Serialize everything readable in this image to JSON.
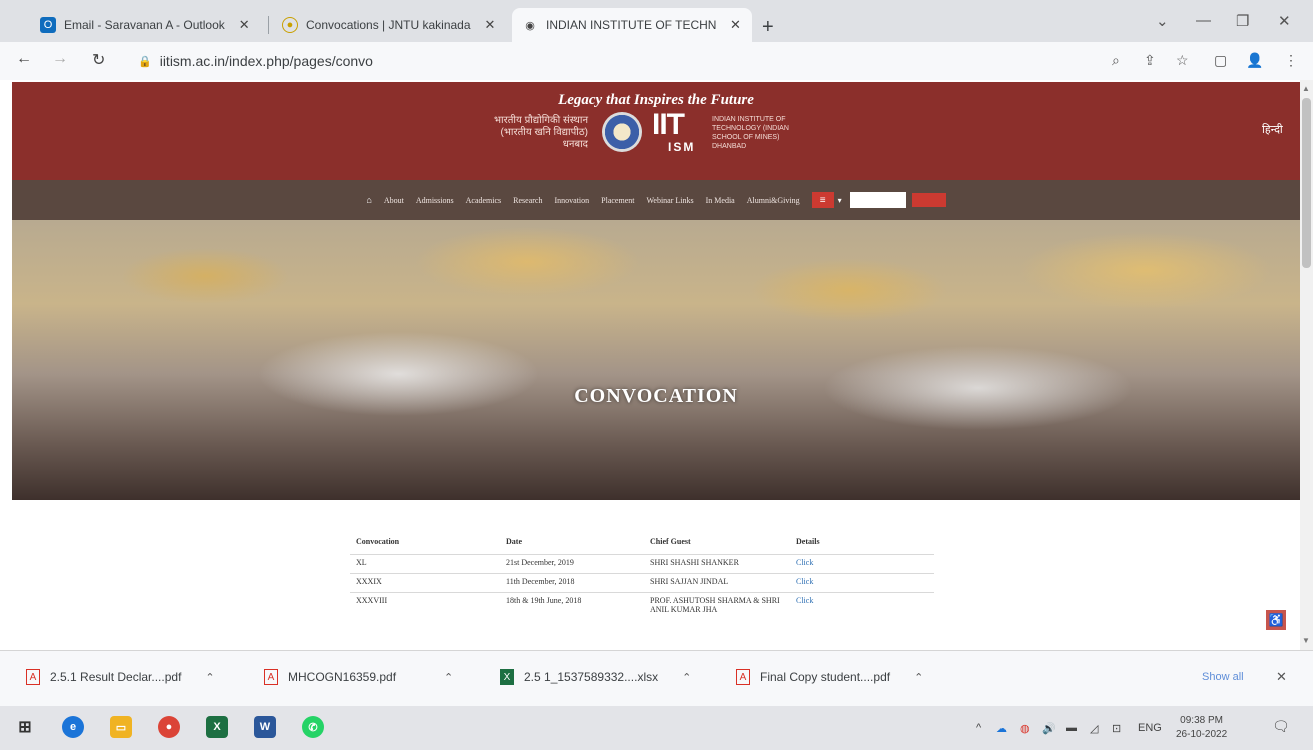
{
  "browser": {
    "tabs": [
      {
        "title": "Email - Saravanan A - Outlook",
        "close": "✕",
        "icon": "outlook-icon"
      },
      {
        "title": "Convocations | JNTU kakinada",
        "close": "✕",
        "icon": "jntu-icon"
      },
      {
        "title": "INDIAN INSTITUTE OF TECHNO",
        "close": "✕",
        "icon": "globe-icon"
      }
    ],
    "new_tab": "+",
    "url": "iitism.ac.in/index.php/pages/convo"
  },
  "site": {
    "tagline": "Legacy that Inspires the Future",
    "hindi_name": "भारतीय प्रौद्योगिकी संस्थान (भारतीय खनि विद्यापीठ) धनबाद",
    "logo_iit": "IIT",
    "logo_ism": "ISM",
    "english_name": "INDIAN INSTITUTE OF TECHNOLOGY (INDIAN SCHOOL OF MINES) DHANBAD",
    "language_toggle": "हिन्दी",
    "nav": [
      "About",
      "Admissions",
      "Academics",
      "Research",
      "Innovation",
      "Placement",
      "Webinar Links",
      "In Media",
      "Alumni&Giving"
    ],
    "search_button": "Search",
    "hero_title": "CONVOCATION"
  },
  "table": {
    "headers": [
      "Convocation",
      "Date",
      "Chief Guest",
      "Details"
    ],
    "rows": [
      {
        "convocation": "XL",
        "date": "21st December, 2019",
        "guest": "SHRI SHASHI SHANKER",
        "details": "Click"
      },
      {
        "convocation": "XXXIX",
        "date": "11th December, 2018",
        "guest": "SHRI SAJJAN JINDAL",
        "details": "Click"
      },
      {
        "convocation": "XXXVIII",
        "date": "18th & 19th June, 2018",
        "guest": "PROF. ASHUTOSH SHARMA & SHRI ANIL KUMAR JHA",
        "details": "Click"
      }
    ]
  },
  "downloads": {
    "items": [
      {
        "name": "2.5.1 Result Declar....pdf",
        "type": "pdf"
      },
      {
        "name": "MHCOGN16359.pdf",
        "type": "pdf"
      },
      {
        "name": "2.5 1_1537589332....xlsx",
        "type": "xlsx"
      },
      {
        "name": "Final Copy student....pdf",
        "type": "pdf"
      }
    ],
    "show_all": "Show all"
  },
  "taskbar": {
    "language": "ENG",
    "time": "09:38 PM",
    "date": "26-10-2022"
  },
  "colors": {
    "header": "#8b2f2b",
    "nav": "#5a4840",
    "accent": "#cc3a31",
    "link": "#2e6fb3"
  }
}
